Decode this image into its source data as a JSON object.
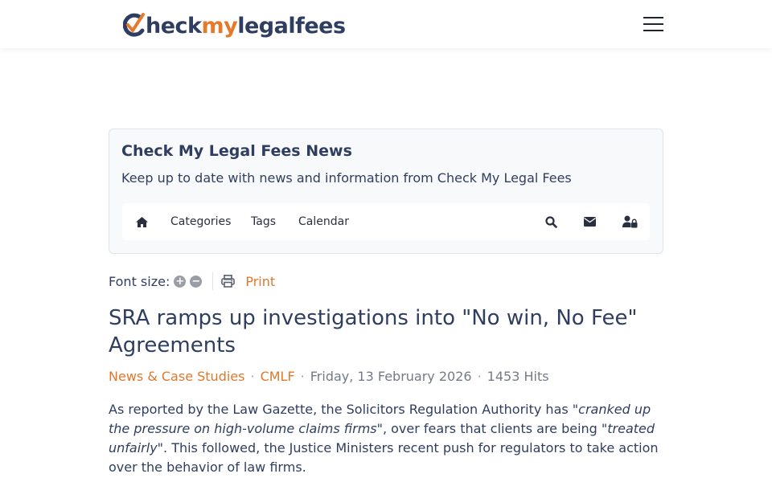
{
  "header": {
    "logo": {
      "part1": "C",
      "part2": "heck",
      "part3": "my",
      "part4": "legalfees"
    },
    "menu_icon": "hamburger-icon"
  },
  "news": {
    "title": "Check My Legal Fees News",
    "subtitle": "Keep up to date with news and information from Check My Legal Fees",
    "nav": {
      "home_icon": "home-icon",
      "categories": "Categories",
      "tags": "Tags",
      "calendar": "Calendar",
      "search_icon": "search-icon",
      "mail_icon": "envelope-icon",
      "login_icon": "user-lock-icon"
    }
  },
  "tools": {
    "font_size_label": "Font size:",
    "increase": "+",
    "decrease": "−",
    "print_icon": "printer-icon",
    "print_label": "Print"
  },
  "article": {
    "title": "SRA ramps up investigations into \"No win, No Fee\" Agreements",
    "category": "News & Case Studies",
    "author": "CMLF",
    "date": "Friday, 13 February 2026",
    "hits": "1453 Hits",
    "separator": "·",
    "body": {
      "p1_a": "As reported by the Law Gazette, the Solicitors Regulation Authority has ",
      "p1_q1": "\"cranked up the pressure on high-volume claims firms\"",
      "p1_b": ", over fears that clients are being ",
      "p1_q2": "\"treated unfairly\"",
      "p1_c": ". This followed, the Justice Ministers recent push for regulators to take action over the behavior of law firms."
    }
  },
  "colors": {
    "navy": "#2f3e60",
    "orange": "#e0782c",
    "muted": "#747b87"
  }
}
